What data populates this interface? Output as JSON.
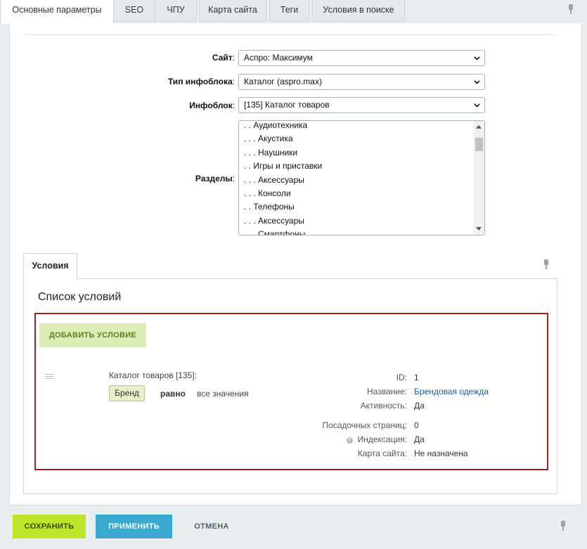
{
  "tabs": [
    {
      "label": "Основные параметры",
      "active": true
    },
    {
      "label": "SEO",
      "active": false
    },
    {
      "label": "ЧПУ",
      "active": false
    },
    {
      "label": "Карта сайта",
      "active": false
    },
    {
      "label": "Теги",
      "active": false
    },
    {
      "label": "Условия в поиске",
      "active": false
    }
  ],
  "form": {
    "site": {
      "label": "Сайт",
      "value": "Аспро: Максимум"
    },
    "iblock_type": {
      "label": "Тип инфоблока",
      "value": "Каталог (aspro.max)"
    },
    "iblock": {
      "label": "Инфоблок",
      "value": "[135] Каталог товаров"
    },
    "sections": {
      "label": "Разделы",
      "items": [
        ". . Аудиотехника",
        ". . . Акустика",
        ". . . Наушники",
        ". . Игры и приставки",
        ". . . Аксессуары",
        ". . . Консоли",
        ". . Телефоны",
        ". . . Аксессуары",
        ". . . Смартфоны"
      ]
    },
    "colon": ":"
  },
  "conditions": {
    "tab_label": "Условия",
    "title": "Список условий",
    "add_button": "ДОБАВИТЬ УСЛОВИЕ",
    "item": {
      "source": "Каталог товаров [135]:",
      "property": "Бренд",
      "operator": "равно",
      "value": "все значения",
      "details": [
        {
          "label": "ID:",
          "value": "1",
          "link": false
        },
        {
          "label": "Название:",
          "value": "Брендовая одежда",
          "link": true
        },
        {
          "label": "Активность:",
          "value": "Да",
          "link": false
        },
        {
          "label": "Посадочных страниц:",
          "value": "0",
          "link": false
        },
        {
          "label": "Индексация:",
          "value": "Да",
          "link": false,
          "help_icon": "?"
        },
        {
          "label": "Карта сайта:",
          "value": "Не назначена",
          "link": false
        }
      ]
    }
  },
  "footer": {
    "save": "СОХРАНИТЬ",
    "apply": "ПРИМЕНИТЬ",
    "cancel": "ОТМЕНА"
  },
  "colors": {
    "save_bg": "#bde427",
    "apply_bg": "#3ba9cd",
    "highlight_border": "#a71f1f",
    "add_btn_bg": "#dcecb7",
    "link": "#1f5a9b"
  }
}
